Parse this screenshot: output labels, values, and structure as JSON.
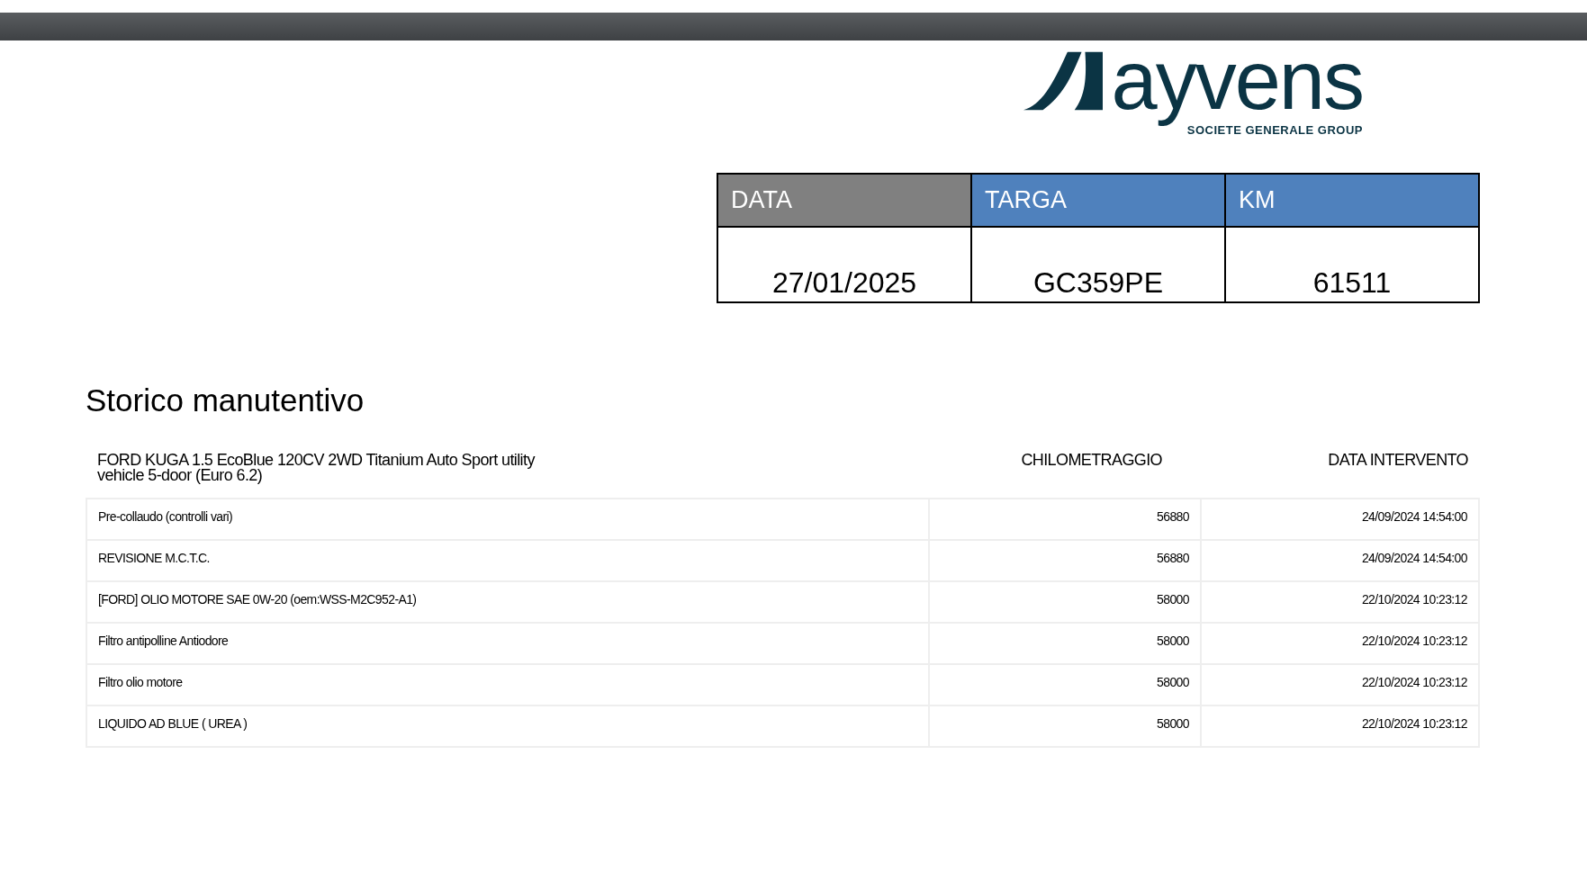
{
  "logo": {
    "wordmark": "ayvens",
    "tagline": "SOCIETE GENERALE GROUP"
  },
  "summary": {
    "columns": [
      {
        "label": "DATA",
        "color": "#808080",
        "value": "27/01/2025"
      },
      {
        "label": "TARGA",
        "color": "#4f81bd",
        "value": "GC359PE"
      },
      {
        "label": "KM",
        "color": "#4f81bd",
        "value": "61511"
      }
    ]
  },
  "history": {
    "title": "Storico manutentivo",
    "columns": [
      "FORD KUGA 1.5 EcoBlue 120CV 2WD Titanium Auto Sport utility vehicle 5-door (Euro 6.2)",
      "CHILOMETRAGGIO",
      "DATA INTERVENTO"
    ],
    "rows": [
      [
        "Pre-collaudo (controlli vari)",
        "56880",
        "24/09/2024 14:54:00"
      ],
      [
        "REVISIONE M.C.T.C.",
        "56880",
        "24/09/2024 14:54:00"
      ],
      [
        "[FORD] OLIO MOTORE SAE 0W-20 (oem:WSS-M2C952-A1)",
        "58000",
        "22/10/2024 10:23:12"
      ],
      [
        "Filtro antipolline Antiodore",
        "58000",
        "22/10/2024 10:23:12"
      ],
      [
        "Filtro olio motore",
        "58000",
        "22/10/2024 10:23:12"
      ],
      [
        "LIQUIDO AD BLUE ( UREA )",
        "58000",
        "22/10/2024 10:23:12"
      ]
    ]
  }
}
